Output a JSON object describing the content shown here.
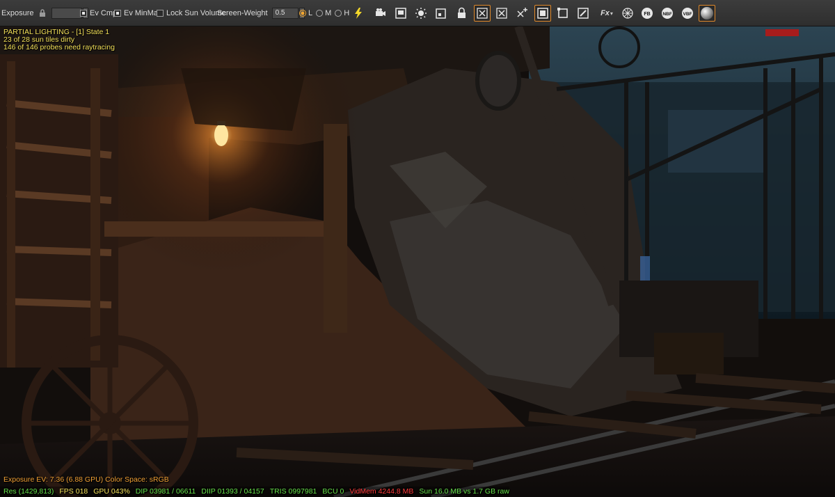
{
  "toolbar": {
    "exposure_label": "Exposure",
    "ev_cmp_label": "Ev Cmp",
    "ev_minmax_label": "Ev MinMax",
    "lock_sun_label": "Lock Sun Volume",
    "screen_weight_label": "Screen-Weight",
    "screen_weight_value": "0.5",
    "quality_options": [
      "L",
      "M",
      "H"
    ],
    "quality_selected": "L",
    "fx_label": "Fx",
    "fb_label": "FB",
    "nbf_label": "NBF",
    "vbf_label": "VBF",
    "accent": "#e28a2b",
    "icons": [
      "lightning-icon",
      "camera-3d-icon",
      "screenshot-3d-icon",
      "light-settings-icon",
      "probe-3d-icon",
      "lock-3d-icon",
      "reset-3d-icon",
      "reset-icon",
      "add-probe-icon",
      "screen-2d-icon",
      "frame-icon",
      "edit-icon",
      "fx-icon",
      "mesh-icon",
      "fb-icon",
      "nbf-icon",
      "vbf-icon",
      "material-ball-icon"
    ]
  },
  "overlay": {
    "line1": "PARTIAL LIGHTING - [1] State 1",
    "line2": "23 of 28 sun tiles dirty",
    "line3": "146 of 146 probes need raytracing"
  },
  "bottom": {
    "exposure": "Exposure EV: 7.36 (6.88 GPU)  Color Space: sRGB",
    "res": "Res (1429,813)",
    "fps": "FPS 018",
    "gpu": "GPU 043%",
    "dip": "DIP 03981 / 06611",
    "diip": "DIIP 01393 / 04157",
    "tris": "TRIS 0997981",
    "bcu": "BCU 0",
    "vidmem": "VidMem 4244.8 MB",
    "sun": "Sun 16.0 MB vs 1.7 GB raw"
  }
}
